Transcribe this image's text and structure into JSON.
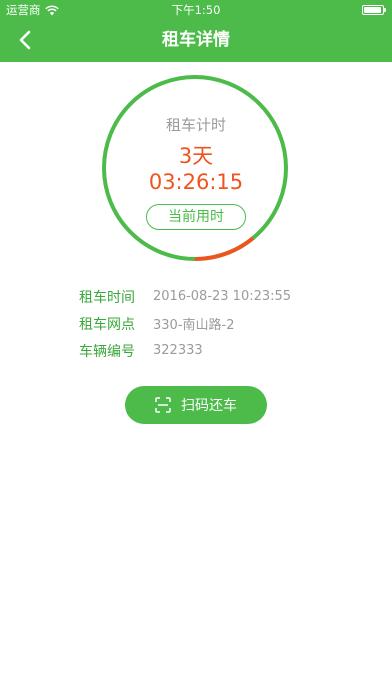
{
  "status_bar": {
    "carrier": "运营商",
    "time": "下午1:50"
  },
  "nav": {
    "title": "租车详情",
    "back_icon": "chevron-left-icon"
  },
  "timer": {
    "label": "租车计时",
    "days": "3天",
    "clock": "03:26:15",
    "badge": "当前用时",
    "progress": 0.11
  },
  "info": {
    "rows": [
      {
        "label": "租车时间",
        "value": "2016-08-23 10:23:55"
      },
      {
        "label": "租车网点",
        "value": "330-南山路-2"
      },
      {
        "label": "车辆编号",
        "value": "322333"
      }
    ]
  },
  "return_button": {
    "label": "扫码还车",
    "icon": "scan-icon"
  },
  "colors": {
    "primary": "#4cbb4a",
    "accent": "#f0541e",
    "muted": "#9b9b9b"
  }
}
